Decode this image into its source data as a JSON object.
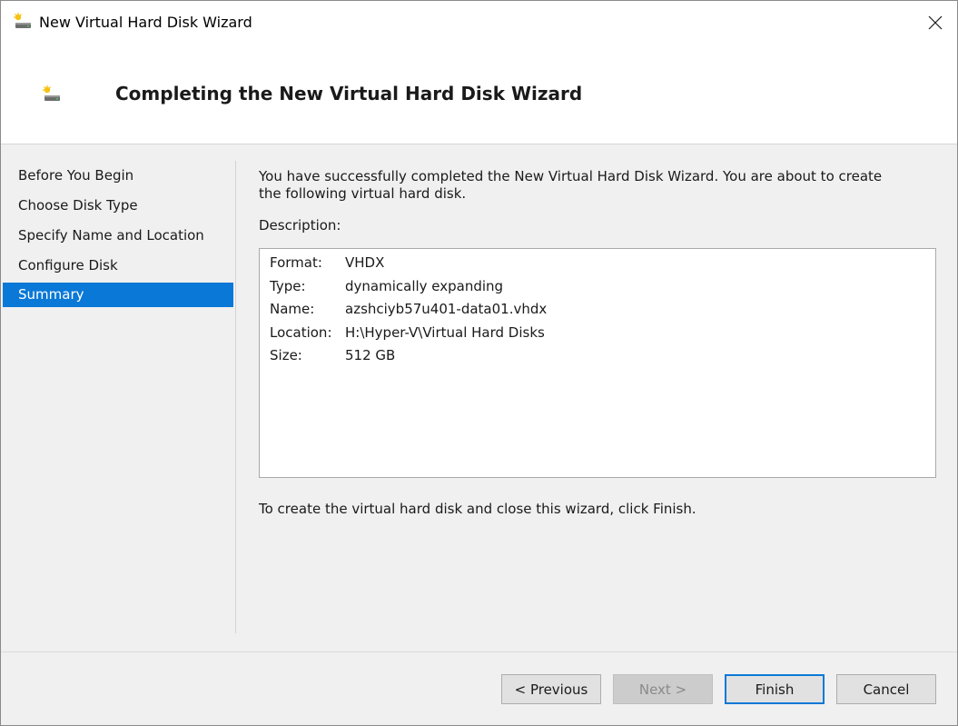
{
  "window": {
    "title": "New Virtual Hard Disk Wizard"
  },
  "header": {
    "title": "Completing the New Virtual Hard Disk Wizard"
  },
  "nav": {
    "items": [
      {
        "label": "Before You Begin"
      },
      {
        "label": "Choose Disk Type"
      },
      {
        "label": "Specify Name and Location"
      },
      {
        "label": "Configure Disk"
      },
      {
        "label": "Summary",
        "selected": true
      }
    ]
  },
  "main": {
    "intro": "You have successfully completed the New Virtual Hard Disk Wizard. You are about to create the following virtual hard disk.",
    "description_label": "Description:",
    "description": [
      {
        "key": "Format:",
        "value": "VHDX"
      },
      {
        "key": "Type:",
        "value": "dynamically expanding"
      },
      {
        "key": "Name:",
        "value": "azshciyb57u401-data01.vhdx"
      },
      {
        "key": "Location:",
        "value": "H:\\Hyper-V\\Virtual Hard Disks"
      },
      {
        "key": "Size:",
        "value": "512 GB"
      }
    ],
    "finish_note": "To create the virtual hard disk and close this wizard, click Finish."
  },
  "buttons": {
    "previous": "< Previous",
    "next": "Next >",
    "finish": "Finish",
    "cancel": "Cancel"
  },
  "colors": {
    "accent": "#0a78d7",
    "selected_text": "#ffffff"
  },
  "icons": {
    "app": "virtual-disk-icon",
    "close": "close-icon"
  }
}
